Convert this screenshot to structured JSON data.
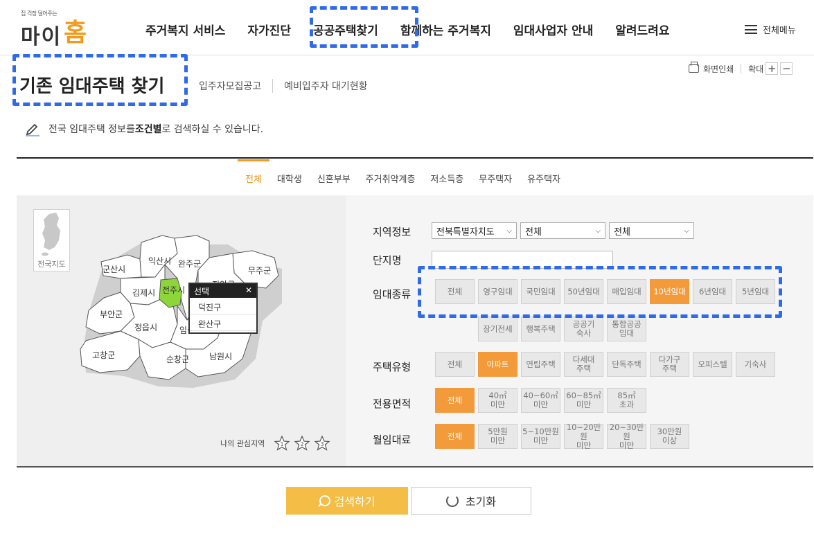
{
  "header": {
    "logo_tagline": "집 걱정 덜어주는",
    "logo_mai": "마이",
    "logo_home": "홈",
    "nav": [
      {
        "label": "주거복지 서비스"
      },
      {
        "label": "자가진단"
      },
      {
        "label": "공공주택찾기",
        "active": true
      },
      {
        "label": "함께하는 주거복지"
      },
      {
        "label": "임대사업자 안내"
      },
      {
        "label": "알려드려요"
      }
    ],
    "all_menu": "전체메뉴"
  },
  "page": {
    "title": "기존 임대주택 찾기",
    "sub_tabs": [
      "입주자모집공고",
      "예비입주자 대기현황"
    ],
    "print": "화면인쇄",
    "zoom": "확대",
    "zoom_in": "+",
    "zoom_out": "−",
    "description_pre": "전국 임대주택 정보를 ",
    "description_bold": "조건별",
    "description_post": "로 검색하실 수 있습니다."
  },
  "tabs": [
    {
      "label": "전체",
      "active": true
    },
    {
      "label": "대학생"
    },
    {
      "label": "신혼부부"
    },
    {
      "label": "주거취약계층"
    },
    {
      "label": "저소득층"
    },
    {
      "label": "무주택자"
    },
    {
      "label": "유주택자"
    }
  ],
  "map": {
    "national_map": "전국지도",
    "districts": [
      "군산시",
      "익산시",
      "완주군",
      "무주군",
      "김제시",
      "전주시",
      "진안군",
      "부안군",
      "정읍시",
      "임실군",
      "고창군",
      "순창군",
      "남원시"
    ],
    "popup_title": "선택",
    "popup_close": "✕",
    "popup_items": [
      "덕진구",
      "완산구"
    ],
    "favorite_label": "나의 관심지역",
    "favorite_stars": [
      "1",
      "2",
      "3"
    ]
  },
  "filters": {
    "region_label": "지역정보",
    "region_selects": [
      "전북특별자치도",
      "전체",
      "전체"
    ],
    "complex_label": "단지명",
    "complex_value": "",
    "rental_label": "임대종류",
    "rental_options": [
      "전체",
      "영구임대",
      "국민임대",
      "50년임대",
      "매입임대",
      "10년임대",
      "6년임대",
      "5년임대",
      "장기전세",
      "행복주택",
      "공공기\n숙사",
      "통합공공\n임대"
    ],
    "rental_selected": "10년임대",
    "housing_label": "주택유형",
    "housing_options": [
      "전체",
      "아파트",
      "연립주택",
      "다세대\n주택",
      "단독주택",
      "다가구\n주택",
      "오피스텔",
      "기숙사"
    ],
    "housing_selected": "아파트",
    "area_label": "전용면적",
    "area_options": [
      "전체",
      "40㎡\n미만",
      "40~60㎡\n미만",
      "60~85㎡\n미만",
      "85㎡\n초과"
    ],
    "area_selected": "전체",
    "rent_label": "월임대료",
    "rent_options": [
      "전체",
      "5만원\n미만",
      "5~10만원\n미만",
      "10~20만원\n미만",
      "20~30만원\n미만",
      "30만원\n이상"
    ],
    "rent_selected": "전체"
  },
  "actions": {
    "search": "검색하기",
    "reset": "초기화"
  },
  "colors": {
    "accent": "#f39a3b",
    "search_button": "#f3bd46",
    "selected_district": "#8dd63a",
    "highlight": "#2f6be8"
  }
}
